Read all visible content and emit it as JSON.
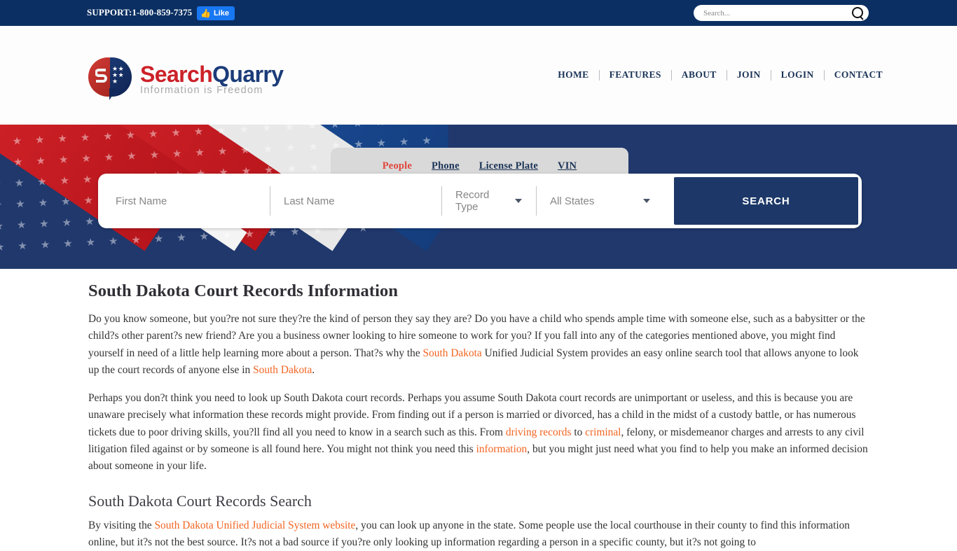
{
  "topbar": {
    "support": "SUPPORT:1-800-859-7375",
    "like_label": "Like",
    "like_icon": "thumbs-up-icon",
    "search_placeholder": "Search...",
    "search_value": "",
    "search_icon": "magnifier-icon",
    "bg_color": "#0b2f62",
    "like_color": "#1877f2"
  },
  "header": {
    "logo_name": "SearchQuarry",
    "logo_word_1": "Search",
    "logo_word_2": "Quarry",
    "logo_tagline": "Information is Freedom",
    "logo_red": "#cc2128",
    "logo_blue": "#1b3c78",
    "nav": [
      {
        "label": "HOME"
      },
      {
        "label": "FEATURES"
      },
      {
        "label": "ABOUT"
      },
      {
        "label": "JOIN"
      },
      {
        "label": "LOGIN"
      },
      {
        "label": "CONTACT"
      }
    ],
    "page_title": "South Dakota Court Records"
  },
  "hero": {
    "bg_color": "#20386c",
    "tabs": [
      {
        "label": "People",
        "active": true
      },
      {
        "label": "Phone",
        "active": false
      },
      {
        "label": "License Plate",
        "active": false
      },
      {
        "label": "VIN",
        "active": false
      }
    ],
    "form": {
      "first_name_placeholder": "First Name",
      "first_name_value": "",
      "last_name_placeholder": "Last Name",
      "last_name_value": "",
      "record_type_label": "Record Type",
      "all_states_label": "All States",
      "search_button": "SEARCH",
      "button_color": "#1d3868"
    }
  },
  "main": {
    "heading": "South Dakota Court Records Information",
    "p1_a": "Do you know someone, but you?re not sure they?re the kind of person they say they are? Do you have a child who spends ample time with someone else, such as a babysitter or the child?s other parent?s new friend? Are you a business owner looking to hire someone to work for you? If you fall into any of the categories mentioned above, you might find yourself in need of a little help learning more about a person. That?s why the ",
    "p1_link1": "South Dakota",
    "p1_b": " Unified Judicial System provides an easy online search tool that allows anyone to look up the court records of anyone else in ",
    "p1_link2": "South Dakota",
    "p1_c": ".",
    "p2_a": "Perhaps you don?t think you need to look up South Dakota court records. Perhaps you assume South Dakota court records are unimportant or useless, and this is because you are unaware precisely what information these records might provide. From finding out if a person is married or divorced, has a child in the midst of a custody battle, or has numerous tickets due to poor driving skills, you?ll find all you need to know in a search such as this. From ",
    "p2_link1": "driving records",
    "p2_b": " to ",
    "p2_link2": "criminal",
    "p2_c": ", felony, or misdemeanor charges and arrests to any civil litigation filed against or by someone is all found here. You might not think you need this ",
    "p2_link3": "information",
    "p2_d": ", but you might just need what you find to help you make an informed decision about someone in your life.",
    "subheading": "South Dakota Court Records Search",
    "p3_a": "By visiting the ",
    "p3_link1": "South Dakota Unified Judicial System website",
    "p3_b": ", you can look up anyone in the state. Some people use the local courthouse in their county to find this information online, but it?s not the best source. It?s not a bad source if you?re only looking up information regarding a person in a specific county, but it?s not going to",
    "link_color": "#f26522"
  }
}
